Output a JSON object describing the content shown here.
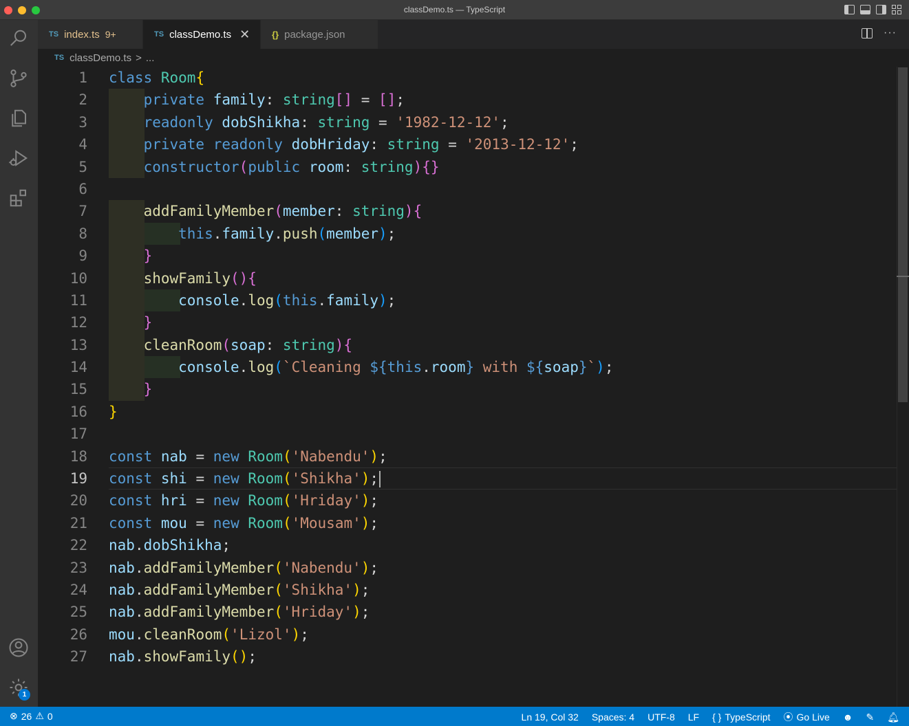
{
  "window": {
    "title": "classDemo.ts — TypeScript"
  },
  "tabs": [
    {
      "icon_text": "TS",
      "label": "index.ts",
      "problems": "9+"
    },
    {
      "icon_text": "TS",
      "label": "classDemo.ts",
      "close": "✕"
    },
    {
      "icon_text": "{}",
      "label": "package.json"
    }
  ],
  "breadcrumb": {
    "icon_text": "TS",
    "file": "classDemo.ts",
    "separator": ">",
    "rest": "..."
  },
  "editor": {
    "line_numbers": [
      "1",
      "2",
      "3",
      "4",
      "5",
      "6",
      "7",
      "8",
      "9",
      "10",
      "11",
      "12",
      "13",
      "14",
      "15",
      "16",
      "17",
      "18",
      "19",
      "20",
      "21",
      "22",
      "23",
      "24",
      "25",
      "26",
      "27"
    ],
    "current_line": 19
  },
  "status": {
    "errors": "26",
    "warnings": "0",
    "position": "Ln 19, Col 32",
    "spaces": "Spaces: 4",
    "encoding": "UTF-8",
    "eol": "LF",
    "language_icon": "{ }",
    "language": "TypeScript",
    "golive": "Go Live"
  },
  "activity": {
    "items": [
      "search-icon",
      "source-control-icon",
      "explorer-icon",
      "run-debug-icon",
      "extensions-icon",
      "account-icon",
      "settings-gear-icon"
    ],
    "settings_badge": "1"
  },
  "colors": {
    "status_bar": "#007acc",
    "keyword": "#569cd6",
    "class": "#4ec9b0",
    "property": "#9cdcfe",
    "string": "#ce9178",
    "function": "#dcdcaa"
  }
}
